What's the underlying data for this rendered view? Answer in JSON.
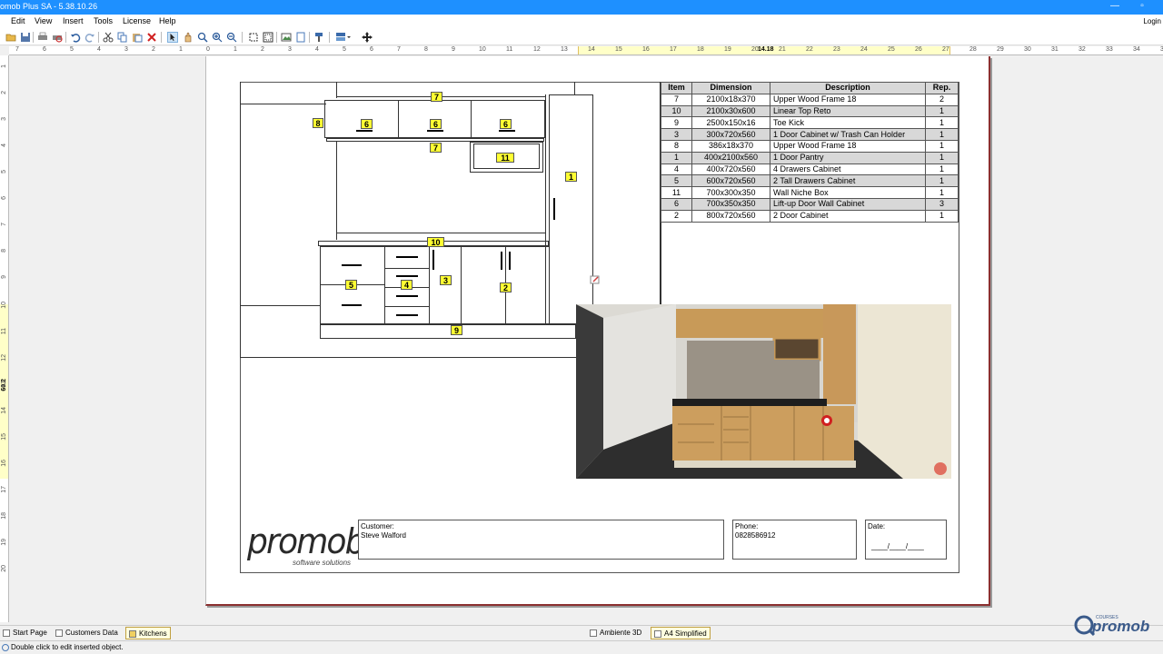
{
  "window": {
    "title": "omob Plus SA - 5.38.10.26",
    "minimize": "—",
    "restore": "▫"
  },
  "menu": {
    "items": [
      "Edit",
      "View",
      "Insert",
      "Tools",
      "License",
      "Help"
    ],
    "login": "Login"
  },
  "toolbar": {
    "buttons": [
      "open-icon",
      "save-icon",
      "print-icon",
      "print-preview-icon",
      "undo-icon",
      "redo-icon",
      "cut-icon",
      "copy-icon",
      "paste-icon",
      "delete-icon",
      "select-arrow-icon",
      "pan-icon",
      "zoom-area-icon",
      "zoom-in-icon",
      "zoom-out-icon",
      "frame-icon",
      "frame-fit-icon",
      "insert-image-icon",
      "insert-text-icon",
      "paint-icon",
      "layout-icon",
      "move-icon"
    ]
  },
  "rulers": {
    "horizontal_ticks": [
      "7",
      "6",
      "5",
      "4",
      "3",
      "2",
      "1",
      "0",
      "1",
      "2",
      "3",
      "4",
      "5",
      "6",
      "7",
      "8",
      "9",
      "10",
      "11",
      "12",
      "13",
      "14",
      "15",
      "16",
      "17",
      "18",
      "19",
      "20",
      "21",
      "22",
      "23",
      "24",
      "25",
      "26",
      "27",
      "28",
      "29",
      "30",
      "31",
      "32",
      "33",
      "34",
      "35"
    ],
    "horizontal_readout": "14.18",
    "vertical_ticks": [
      "1",
      "2",
      "3",
      "4",
      "5",
      "6",
      "7",
      "8",
      "9",
      "10",
      "11",
      "12",
      "13",
      "14",
      "15",
      "16",
      "17",
      "18",
      "19",
      "20"
    ],
    "vertical_readout": "60.2"
  },
  "elevation": {
    "tags": [
      "7",
      "6",
      "6",
      "6",
      "8",
      "7",
      "11",
      "1",
      "10",
      "5",
      "4",
      "3",
      "2",
      "9"
    ]
  },
  "parts_table": {
    "headers": [
      "Item",
      "Dimension",
      "Description",
      "Rep."
    ],
    "rows": [
      [
        "7",
        "2100x18x370",
        "Upper Wood Frame 18",
        "2"
      ],
      [
        "10",
        "2100x30x600",
        "Linear Top Reto",
        "1"
      ],
      [
        "9",
        "2500x150x16",
        "Toe Kick",
        "1"
      ],
      [
        "3",
        "300x720x560",
        "1 Door Cabinet w/ Trash Can Holder",
        "1"
      ],
      [
        "8",
        "386x18x370",
        "Upper Wood Frame 18",
        "1"
      ],
      [
        "1",
        "400x2100x560",
        "1 Door Pantry",
        "1"
      ],
      [
        "4",
        "400x720x560",
        "4 Drawers Cabinet",
        "1"
      ],
      [
        "5",
        "600x720x560",
        "2 Tall Drawers Cabinet",
        "1"
      ],
      [
        "11",
        "700x300x350",
        "Wall Niche Box",
        "1"
      ],
      [
        "6",
        "700x350x350",
        "Lift-up Door Wall Cabinet",
        "3"
      ],
      [
        "2",
        "800x720x560",
        "2 Door Cabinet",
        "1"
      ]
    ]
  },
  "footer": {
    "logo": "promob",
    "logo_sub": "software solutions",
    "customer_label": "Customer:",
    "customer_value": "Steve Walford",
    "phone_label": "Phone:",
    "phone_value": "0828586912",
    "date_label": "Date:",
    "date_value": "____/____/____"
  },
  "sheet_tabs": {
    "left": [
      "Start Page",
      "Customers Data",
      "Kitchens"
    ],
    "center": [
      "Ambiente 3D",
      "A4 Simplified"
    ]
  },
  "status": {
    "text": "Double click to edit inserted object."
  },
  "corner_logo": {
    "small": "COURSES",
    "main": "promob"
  },
  "colors": {
    "titlebar": "#1e90ff",
    "tag_yellow": "#ffff33",
    "sheet_border": "#8b3030",
    "table_shade": "#d8d8d8"
  }
}
